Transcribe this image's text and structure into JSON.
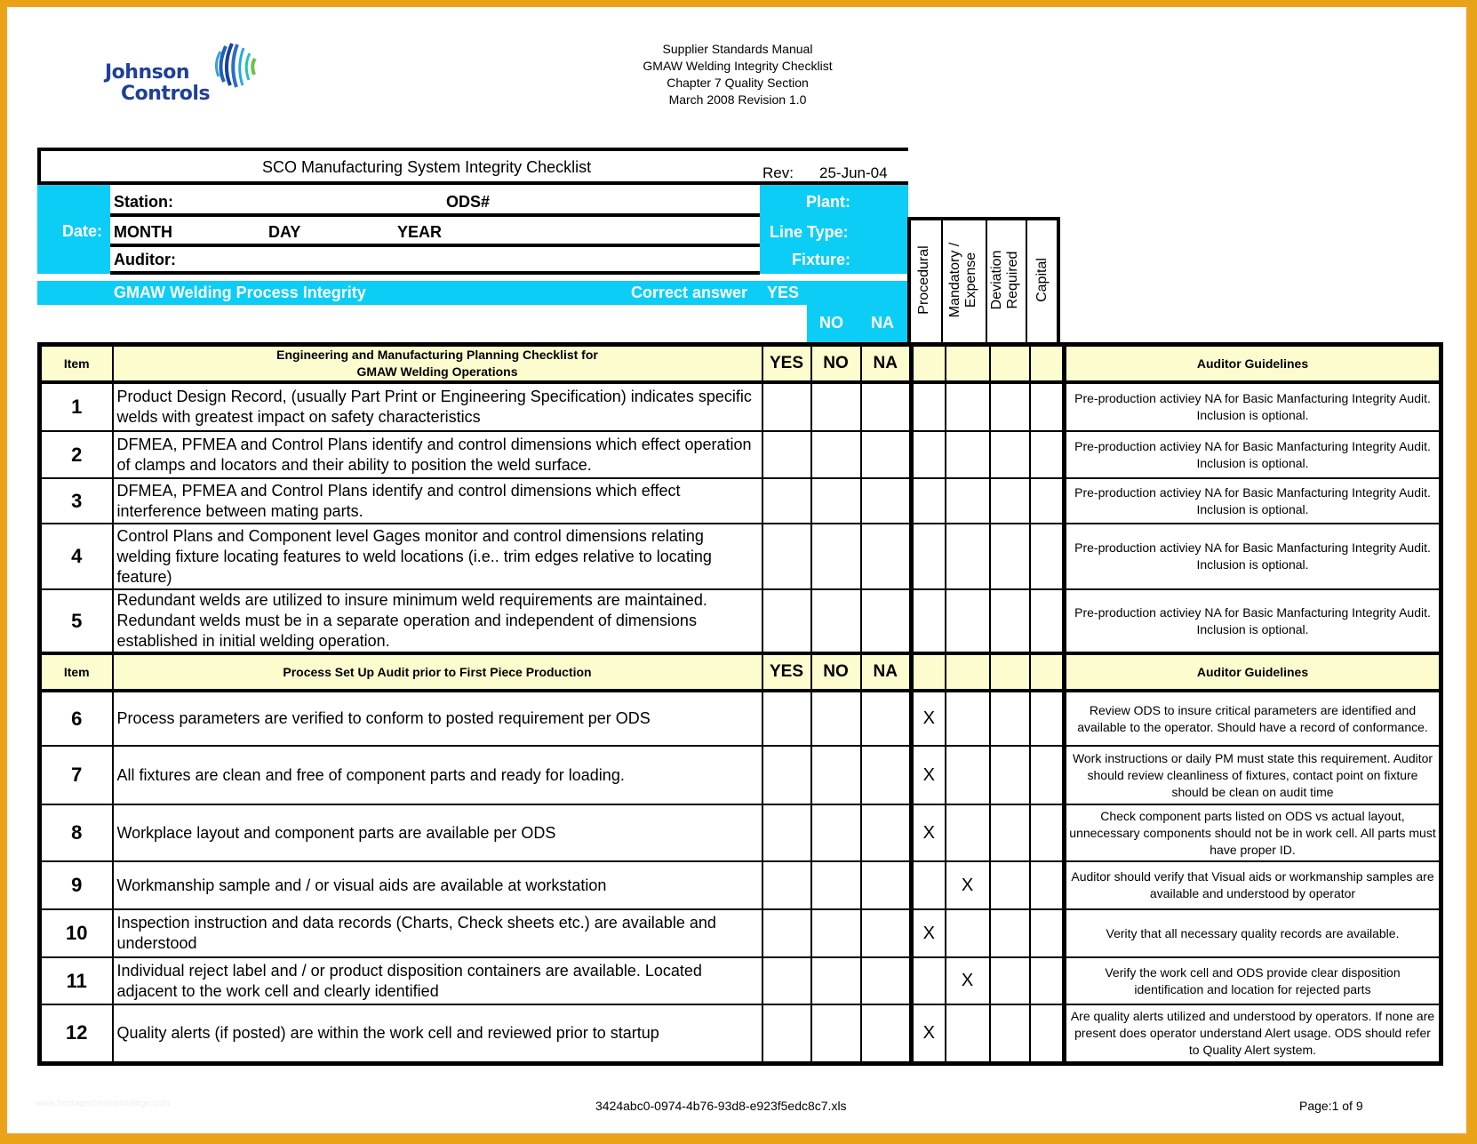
{
  "header": {
    "logo": {
      "line1": "Johnson",
      "line2": "Controls",
      "icon": "johnson-controls-globe-logo"
    },
    "doc_title_lines": [
      "Supplier Standards Manual",
      "GMAW Welding Integrity Checklist",
      "Chapter 7 Quality Section",
      "March 2008 Revision 1.0"
    ]
  },
  "form": {
    "title": "SCO Manufacturing System Integrity Checklist",
    "rev_label": "Rev:",
    "rev_value": "25-Jun-04",
    "date_label": "Date:",
    "station_label": "Station:",
    "ods_label": "ODS#",
    "month_label": "MONTH",
    "day_label": "DAY",
    "year_label": "YEAR",
    "auditor_label": "Auditor:",
    "plant_label": "Plant:",
    "line_type_label": "Line Type:",
    "fixture_label": "Fixture:",
    "band_title": "GMAW Welding Process Integrity",
    "correct_answer_label": "Correct answer",
    "yes": "YES",
    "no": "NO",
    "na": "NA"
  },
  "category_headers": [
    "Procedural",
    "Mandatory / Expense",
    "Deviation Required",
    "Capital"
  ],
  "category_lines": [
    [
      "Procedural"
    ],
    [
      "Mandatory /",
      "Expense"
    ],
    [
      "Deviation",
      "Required"
    ],
    [
      "Capital"
    ]
  ],
  "colors": {
    "accent_cyan": "#0ccdf6",
    "header_fill": "#fdfccf",
    "page_border": "#f0a020"
  },
  "sections": [
    {
      "header": {
        "item": "Item",
        "title": "Engineering and Manufacturing Planning Checklist for GMAW Welding Operations",
        "title_line1": "Engineering and Manufacturing Planning Checklist for",
        "title_line2": "GMAW Welding Operations",
        "yes": "YES",
        "no": "NO",
        "na": "NA",
        "guidelines": "Auditor Guidelines"
      },
      "rows": [
        {
          "item": "1",
          "desc": "Product Design Record, (usually Part Print or Engineering Specification) indicates specific welds with greatest impact on safety characteristics",
          "marks": [
            "",
            "",
            "",
            ""
          ],
          "guideline": "Pre-production activiey NA for Basic Manfacturing Integrity Audit. Inclusion is optional."
        },
        {
          "item": "2",
          "desc": "DFMEA, PFMEA and Control Plans identify and control dimensions which effect operation of clamps and locators and their ability to position the weld surface.",
          "marks": [
            "",
            "",
            "",
            ""
          ],
          "guideline": "Pre-production activiey NA for Basic Manfacturing Integrity Audit. Inclusion is optional."
        },
        {
          "item": "3",
          "desc": "DFMEA, PFMEA and Control Plans identify and control dimensions which effect interference between mating parts.",
          "marks": [
            "",
            "",
            "",
            ""
          ],
          "guideline": "Pre-production activiey NA for Basic Manfacturing Integrity Audit. Inclusion is optional."
        },
        {
          "item": "4",
          "desc": "Control Plans and Component level Gages monitor and control dimensions relating welding fixture locating features  to weld locations (i.e.. trim edges relative to locating feature)",
          "marks": [
            "",
            "",
            "",
            ""
          ],
          "guideline": "Pre-production activiey NA for Basic Manfacturing Integrity Audit. Inclusion is optional."
        },
        {
          "item": "5",
          "desc": "Redundant welds are utilized to insure minimum weld requirements are maintained. Redundant welds must be in a separate operation and independent of dimensions established in initial welding operation.",
          "marks": [
            "",
            "",
            "",
            ""
          ],
          "guideline": "Pre-production activiey NA for Basic Manfacturing Integrity Audit. Inclusion is optional."
        }
      ]
    },
    {
      "header": {
        "item": "Item",
        "title": "Process Set Up Audit prior to First Piece Production",
        "title_line1": "Process Set Up Audit prior to First Piece Production",
        "title_line2": "",
        "yes": "YES",
        "no": "NO",
        "na": "NA",
        "guidelines": "Auditor Guidelines"
      },
      "rows": [
        {
          "item": "6",
          "desc": "Process parameters are verified to conform to posted requirement per ODS",
          "marks": [
            "X",
            "",
            "",
            ""
          ],
          "guideline": "Review ODS to insure critical parameters are identified and available to the operator. Should have a record of conformance."
        },
        {
          "item": "7",
          "desc": "All fixtures are clean and free of component parts and ready for loading.",
          "marks": [
            "X",
            "",
            "",
            ""
          ],
          "guideline": "Work instructions or daily PM must state this requirement. Auditor should review cleanliness of fixtures, contact point on fixture should be clean on audit time"
        },
        {
          "item": "8",
          "desc": "Workplace layout and component parts are available per ODS",
          "marks": [
            "X",
            "",
            "",
            ""
          ],
          "guideline": "Check component parts listed on ODS vs actual layout, unnecessary components should not be in work cell. All parts must have proper ID."
        },
        {
          "item": "9",
          "desc": "Workmanship sample and / or visual aids are available at workstation",
          "marks": [
            "",
            "X",
            "",
            ""
          ],
          "guideline": "Auditor should verify that Visual aids or workmanship samples are available and understood by operator"
        },
        {
          "item": "10",
          "desc": "Inspection instruction and data records (Charts, Check sheets etc.) are available and understood",
          "marks": [
            "X",
            "",
            "",
            ""
          ],
          "guideline": "Verity that all necessary quality records are available."
        },
        {
          "item": "11",
          "desc": "Individual reject label and / or product disposition containers are available. Located adjacent to the work cell and clearly identified",
          "marks": [
            "",
            "X",
            "",
            ""
          ],
          "guideline": "Verify the work cell and ODS provide clear disposition identification and location for rejected parts"
        },
        {
          "item": "12",
          "desc": "Quality alerts (if posted) are within the work cell and reviewed prior to startup",
          "marks": [
            "X",
            "",
            "",
            ""
          ],
          "guideline": "Are quality alerts utilized and understood by operators. If none are present does operator understand Alert usage. ODS should refer to Quality Alert system."
        }
      ]
    }
  ],
  "footer": {
    "file_name": "3424abc0-0974-4b76-93d8-e923f5edc8c7.xls",
    "page": "Page:1 of 9",
    "watermark": "www.heritagechristiancollege.com"
  }
}
